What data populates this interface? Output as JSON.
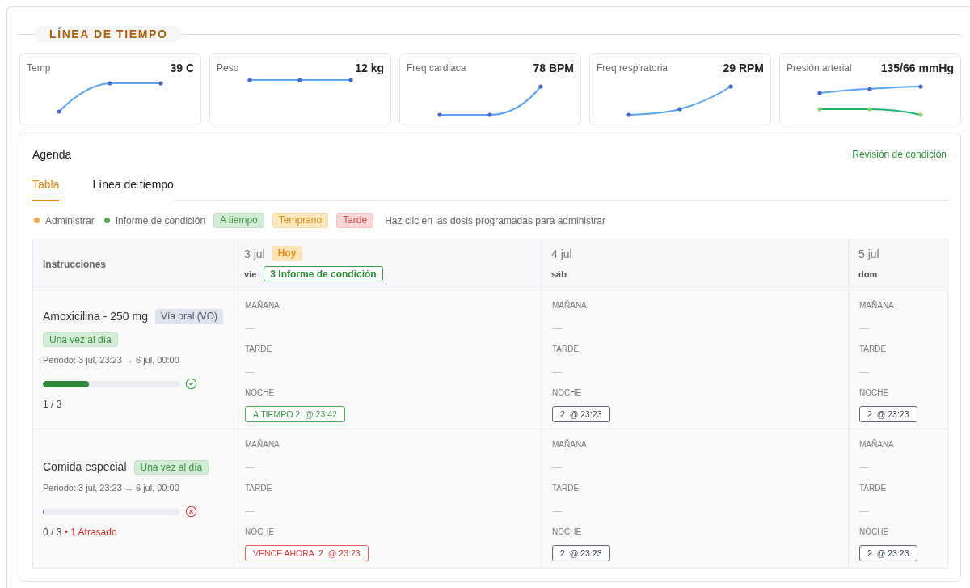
{
  "section": {
    "title": "LÍNEA DE TIEMPO"
  },
  "vitals": [
    {
      "label": "Temp",
      "value": "39 C"
    },
    {
      "label": "Peso",
      "value": "12 kg"
    },
    {
      "label": "Freq cardiaca",
      "value": "78 BPM"
    },
    {
      "label": "Freq respiratoria",
      "value": "29 RPM"
    },
    {
      "label": "Presión arterial",
      "value": "135/66 mmHg"
    }
  ],
  "agenda": {
    "title": "Agenda",
    "action": "Revisión de condición",
    "tabs": [
      {
        "label": "Tabla",
        "selected": true
      },
      {
        "label": "Línea de tiempo",
        "selected": false
      }
    ],
    "legend": [
      {
        "kind": "dot",
        "label": "Administrar",
        "color": "#f0a64a"
      },
      {
        "kind": "dot",
        "label": "Informe de condición",
        "color": "#5aa65f"
      },
      {
        "kind": "on_time",
        "label": "A tiempo"
      },
      {
        "kind": "early",
        "label": "Temprano"
      },
      {
        "kind": "late",
        "label": "Tarde"
      }
    ],
    "hint": "Haz clic en las dosis programadas para administrar",
    "schedule": {
      "header": "Instrucciones",
      "days": [
        {
          "date": "3 jul",
          "badge": "Hoy",
          "weekday": "vie",
          "reports": "3 Informe de condición"
        },
        {
          "date": "4 jul",
          "weekday": "sáb"
        },
        {
          "date": "5 jul",
          "weekday": "dom"
        }
      ],
      "rows": [
        {
          "name": "Amoxicilina - 250 mg",
          "route": "Vía oral (VO)",
          "frequency": "Una vez al día",
          "period": "Periodo: 3 jul, 23:23 → 6 jul, 00:00",
          "level": 0.333,
          "kind": "ok",
          "count": "1 / 3",
          "days": [
            {
              "slots": [
                {
                  "label": "MAÑANA",
                  "kind": "empty",
                  "value": "—"
                },
                {
                  "label": "TARDE",
                  "kind": "empty",
                  "value": "—"
                },
                {
                  "label": "NOCHE",
                  "kind": "on_time",
                  "value": "A TIEMPO 2  @ 23:42"
                }
              ]
            },
            {
              "slots": [
                {
                  "label": "MAÑANA",
                  "kind": "empty",
                  "value": "—"
                },
                {
                  "label": "TARDE",
                  "kind": "empty",
                  "value": "—"
                },
                {
                  "label": "NOCHE",
                  "kind": "scheduled",
                  "value": "2  @ 23:23"
                }
              ]
            },
            {
              "slots": [
                {
                  "label": "MAÑANA",
                  "kind": "empty",
                  "value": "—"
                },
                {
                  "label": "TARDE",
                  "kind": "empty",
                  "value": "—"
                },
                {
                  "label": "NOCHE",
                  "kind": "scheduled",
                  "value": "2  @ 23:23"
                }
              ]
            }
          ]
        },
        {
          "name": "Comida especial",
          "frequency": "Una vez al día",
          "period": "Periodo: 3 jul, 23:23 → 6 jul, 00:00",
          "level": 0,
          "kind": "overdue",
          "count": "0 / 3",
          "overdue": "• 1 Atrasado",
          "days": [
            {
              "slots": [
                {
                  "label": "MAÑANA",
                  "kind": "empty",
                  "value": "—"
                },
                {
                  "label": "TARDE",
                  "kind": "empty",
                  "value": "—"
                },
                {
                  "label": "NOCHE",
                  "kind": "due_now",
                  "value": "VENCE AHORA  2  @ 23:23"
                }
              ]
            },
            {
              "slots": [
                {
                  "label": "MAÑANA",
                  "kind": "empty",
                  "value": "—"
                },
                {
                  "label": "TARDE",
                  "kind": "empty",
                  "value": "—"
                },
                {
                  "label": "NOCHE",
                  "kind": "scheduled",
                  "value": "2  @ 23:23"
                }
              ]
            },
            {
              "slots": [
                {
                  "label": "MAÑANA",
                  "kind": "empty",
                  "value": "—"
                },
                {
                  "label": "TARDE",
                  "kind": "empty",
                  "value": "—"
                },
                {
                  "label": "NOCHE",
                  "kind": "scheduled",
                  "value": "2  @ 23:23"
                }
              ]
            }
          ]
        }
      ]
    }
  }
}
